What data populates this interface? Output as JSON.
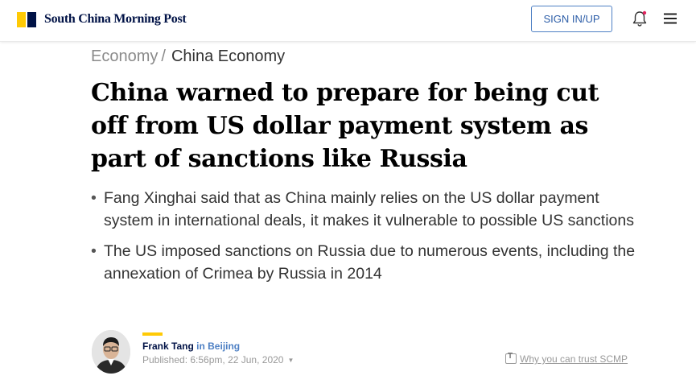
{
  "header": {
    "brand": "South China Morning Post",
    "signin_label": "SIGN IN/UP",
    "icons": [
      "bell-icon",
      "menu-icon"
    ],
    "colors": {
      "brand_yellow": "#ffca05",
      "brand_navy": "#001246",
      "accent_blue": "#4e80c4"
    }
  },
  "breadcrumb": {
    "section": "Economy",
    "separator": "/",
    "current": "China Economy"
  },
  "article": {
    "headline": "China warned to prepare for being cut off from US dollar payment system as part of sanctions like Russia",
    "summary": [
      "Fang Xinghai said that as China mainly relies on the US dollar payment system in international deals, it makes it vulnerable to possible US sanctions",
      "The US imposed sanctions on Russia due to numerous events, including the annexation of Crimea by Russia in 2014"
    ]
  },
  "byline": {
    "author": "Frank Tang",
    "location": "in Beijing",
    "published": "Published: 6:56pm, 22 Jun, 2020",
    "trust_label": "Why you can trust SCMP"
  }
}
